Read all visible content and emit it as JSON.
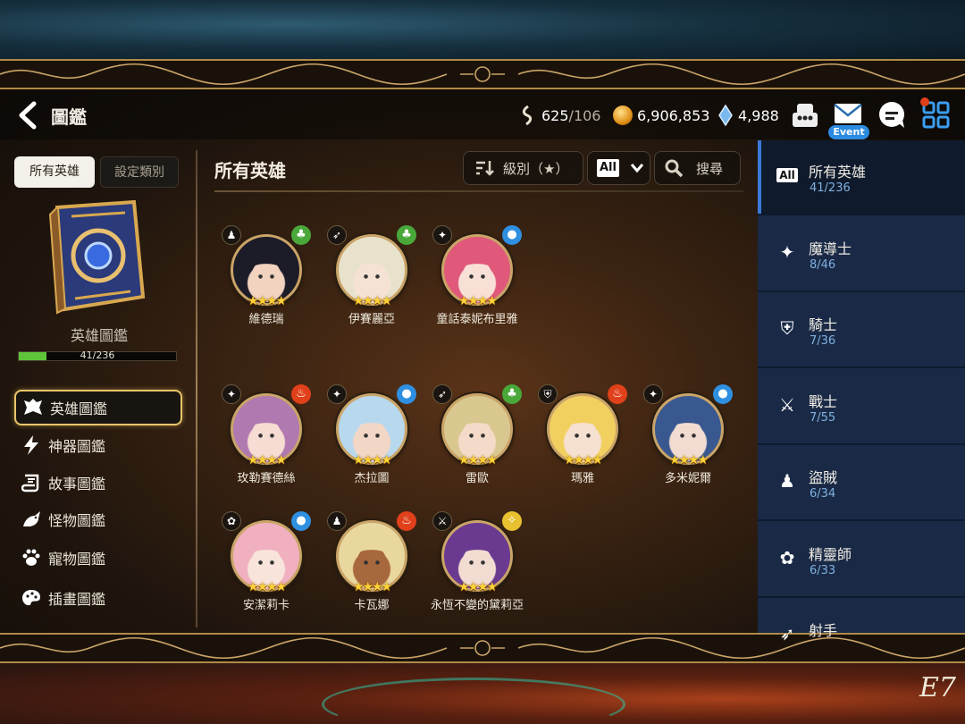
{
  "header": {
    "title": "圖鑑",
    "stamina": {
      "value": "625",
      "max": "/106"
    },
    "gold": "6,906,853",
    "skystone": "4,988",
    "event_label": "Event"
  },
  "left": {
    "tabs": [
      {
        "label": "所有英雄"
      },
      {
        "label": "設定類別"
      }
    ],
    "book_label": "英雄圖鑑",
    "progress": {
      "text": "41/236",
      "fraction": 0.174
    },
    "menu": [
      {
        "label": "英雄圖鑑",
        "icon": "hero-icon"
      },
      {
        "label": "神器圖鑑",
        "icon": "lightning-icon"
      },
      {
        "label": "故事圖鑑",
        "icon": "scroll-icon"
      },
      {
        "label": "怪物圖鑑",
        "icon": "dragon-icon"
      },
      {
        "label": "寵物圖鑑",
        "icon": "paw-icon"
      },
      {
        "label": "插畫圖鑑",
        "icon": "palette-icon"
      }
    ]
  },
  "center": {
    "title": "所有英雄",
    "sort_label": "級別（★）",
    "filter_label": "All",
    "search_label": "搜尋",
    "heroes": [
      {
        "name": "維德瑞",
        "stars": "★★★★",
        "class_icon": "thief-icon",
        "element": "earth",
        "element_color": "#4aa83a",
        "hair": "#1c1c28",
        "skin": "#f2d3c0"
      },
      {
        "name": "伊賽麗亞",
        "stars": "★★★★",
        "class_icon": "ranger-icon",
        "element": "earth",
        "element_color": "#4aa83a",
        "hair": "#e8e2cc",
        "skin": "#f6e2d4"
      },
      {
        "name": "童話泰妮布里雅",
        "stars": "★★★★",
        "class_icon": "mage-icon",
        "element": "ice",
        "element_color": "#2f8fe0",
        "hair": "#e0587a",
        "skin": "#f8e0d6"
      },
      {
        "name": "玫勒賽德絲",
        "stars": "★★★★",
        "class_icon": "mage-icon",
        "element": "fire",
        "element_color": "#e0401a",
        "hair": "#b07ab0",
        "skin": "#f6dcd2"
      },
      {
        "name": "杰拉圖",
        "stars": "★★★★",
        "class_icon": "mage-icon",
        "element": "ice",
        "element_color": "#2f8fe0",
        "hair": "#b8d8ee",
        "skin": "#f2d6c6"
      },
      {
        "name": "雷歐",
        "stars": "★★★★",
        "class_icon": "ranger-icon",
        "element": "earth",
        "element_color": "#4aa83a",
        "hair": "#d8c890",
        "skin": "#f4dac8"
      },
      {
        "name": "瑪雅",
        "stars": "★★★★",
        "class_icon": "knight-icon",
        "element": "fire",
        "element_color": "#e0401a",
        "hair": "#f2d060",
        "skin": "#f6e0d0"
      },
      {
        "name": "多米妮爾",
        "stars": "★★★★",
        "class_icon": "mage-icon",
        "element": "ice",
        "element_color": "#2f8fe0",
        "hair": "#3a5890",
        "skin": "#f2dcd2"
      },
      {
        "name": "安潔莉卡",
        "stars": "★★★★",
        "class_icon": "soul-weaver-icon",
        "element": "ice",
        "element_color": "#2f8fe0",
        "hair": "#f0b0c0",
        "skin": "#f8e4da"
      },
      {
        "name": "卡瓦娜",
        "stars": "★★★★",
        "class_icon": "thief-icon",
        "element": "fire",
        "element_color": "#e0401a",
        "hair": "#e8d8a0",
        "skin": "#a8683e"
      },
      {
        "name": "永恆不變的黛莉亞",
        "stars": "★★★★",
        "class_icon": "warrior-icon",
        "element": "light",
        "element_color": "#e8c030",
        "hair": "#6a3a90",
        "skin": "#f2dcd2"
      }
    ]
  },
  "right": {
    "categories": [
      {
        "name": "所有英雄",
        "count": "41/236",
        "icon": "all-icon"
      },
      {
        "name": "魔導士",
        "count": "8/46",
        "icon": "mage-icon"
      },
      {
        "name": "騎士",
        "count": "7/36",
        "icon": "knight-icon"
      },
      {
        "name": "戰士",
        "count": "7/55",
        "icon": "warrior-icon"
      },
      {
        "name": "盜賊",
        "count": "6/34",
        "icon": "thief-icon"
      },
      {
        "name": "精靈師",
        "count": "6/33",
        "icon": "soul-weaver-icon"
      },
      {
        "name": "射手",
        "count": "",
        "icon": "ranger-icon"
      }
    ]
  },
  "badge_all": "All",
  "logo": "E7"
}
